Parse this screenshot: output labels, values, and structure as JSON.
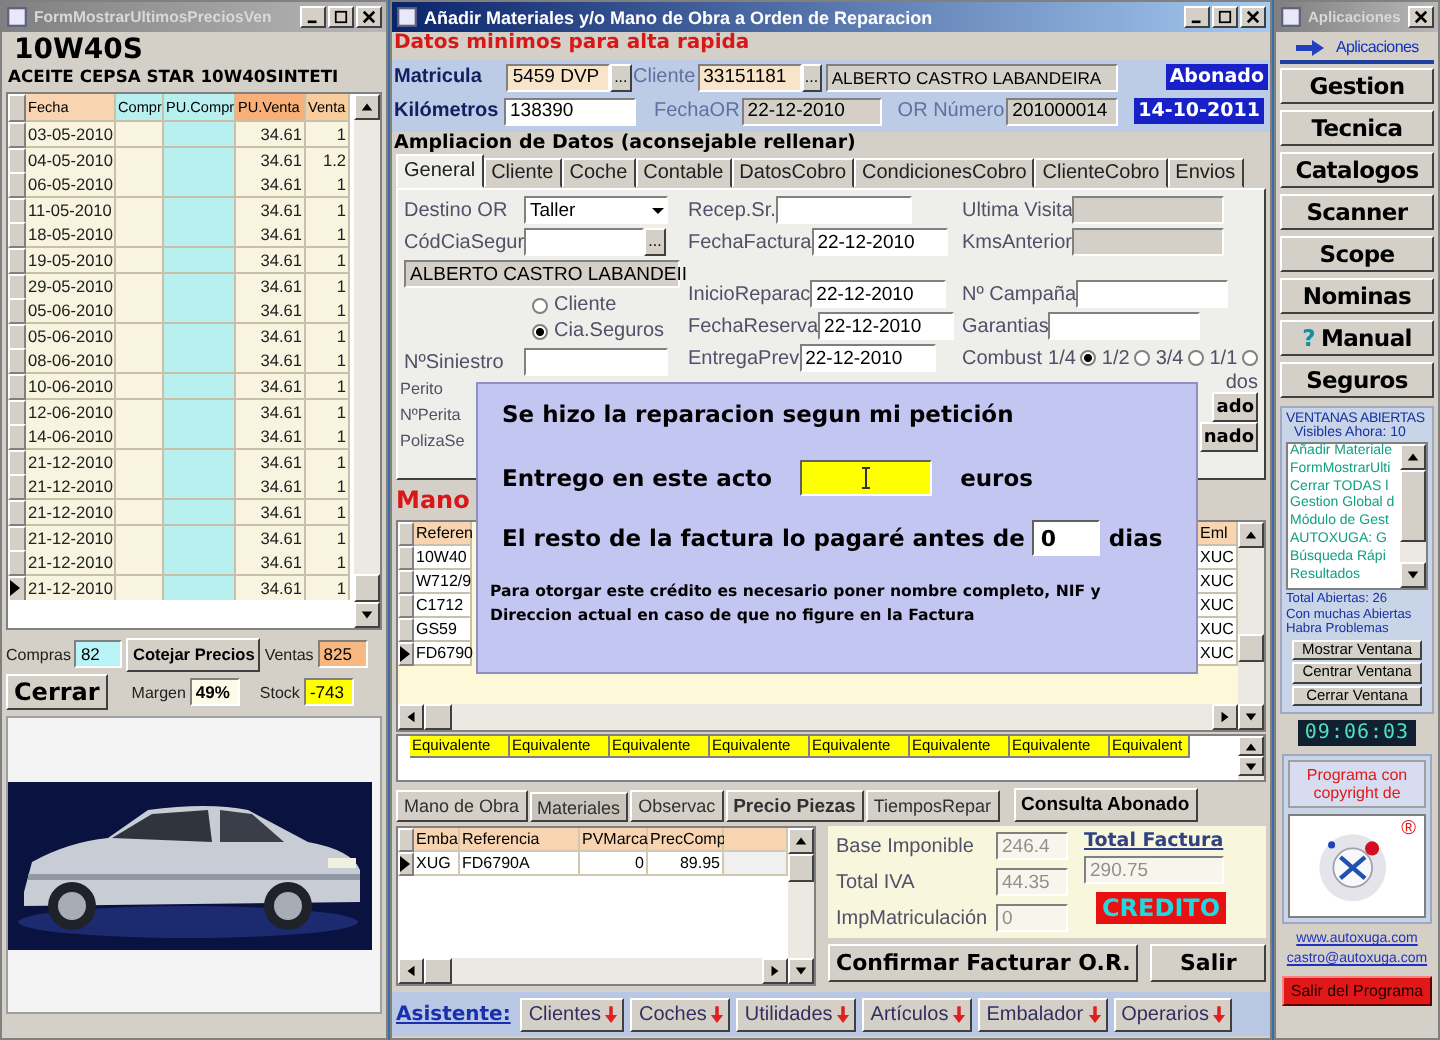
{
  "left_window": {
    "title": "FormMostrarUltimosPreciosVen",
    "code": "10W40S",
    "description": "ACEITE CEPSA STAR 10W40SINTETI",
    "columns": [
      "Fecha",
      "Compr",
      "PU.Compr",
      "PU.Venta",
      "Venta"
    ],
    "rows": [
      {
        "fecha": "03-05-2010",
        "pu_venta": "34.61",
        "venta": "1",
        "selected": false
      },
      {
        "fecha": "04-05-2010",
        "pu_venta": "34.61",
        "venta": "1.2",
        "selected": false
      },
      {
        "fecha": "06-05-2010",
        "pu_venta": "34.61",
        "venta": "1",
        "selected": false
      },
      {
        "fecha": "11-05-2010",
        "pu_venta": "34.61",
        "venta": "1",
        "selected": false
      },
      {
        "fecha": "18-05-2010",
        "pu_venta": "34.61",
        "venta": "1",
        "selected": false
      },
      {
        "fecha": "19-05-2010",
        "pu_venta": "34.61",
        "venta": "1",
        "selected": false
      },
      {
        "fecha": "29-05-2010",
        "pu_venta": "34.61",
        "venta": "1",
        "selected": false
      },
      {
        "fecha": "05-06-2010",
        "pu_venta": "34.61",
        "venta": "1",
        "selected": false
      },
      {
        "fecha": "05-06-2010",
        "pu_venta": "34.61",
        "venta": "1",
        "selected": false
      },
      {
        "fecha": "08-06-2010",
        "pu_venta": "34.61",
        "venta": "1",
        "selected": false
      },
      {
        "fecha": "10-06-2010",
        "pu_venta": "34.61",
        "venta": "1",
        "selected": false
      },
      {
        "fecha": "12-06-2010",
        "pu_venta": "34.61",
        "venta": "1",
        "selected": false
      },
      {
        "fecha": "14-06-2010",
        "pu_venta": "34.61",
        "venta": "1",
        "selected": false
      },
      {
        "fecha": "21-12-2010",
        "pu_venta": "34.61",
        "venta": "1",
        "selected": false
      },
      {
        "fecha": "21-12-2010",
        "pu_venta": "34.61",
        "venta": "1",
        "selected": false
      },
      {
        "fecha": "21-12-2010",
        "pu_venta": "34.61",
        "venta": "1",
        "selected": false
      },
      {
        "fecha": "21-12-2010",
        "pu_venta": "34.61",
        "venta": "1",
        "selected": false
      },
      {
        "fecha": "21-12-2010",
        "pu_venta": "34.61",
        "venta": "1",
        "selected": false
      },
      {
        "fecha": "21-12-2010",
        "pu_venta": "34.61",
        "venta": "1",
        "selected": true
      }
    ],
    "compras": {
      "label": "Compras",
      "value": "82"
    },
    "cotejar_button": "Cotejar Precios",
    "ventas": {
      "label": "Ventas",
      "value": "825"
    },
    "cerrar_button": "Cerrar",
    "margen": {
      "label": "Margen",
      "value": "49%"
    },
    "stock": {
      "label": "Stock",
      "value": "-743"
    },
    "photo": {
      "kind": "picture"
    }
  },
  "main_window": {
    "title": "Añadir Materiales y/o Mano de Obra a Orden de Reparacion",
    "heading": "Datos minimos para alta rapida",
    "matricula": {
      "label": "Matricula",
      "value": "5459 DVP",
      "browse": "..."
    },
    "cliente": {
      "label": "Cliente",
      "value": "33151181",
      "browse": "...",
      "name": "ALBERTO CASTRO LABANDEIRA"
    },
    "abonado_badge": "Abonado",
    "kilometros": {
      "label": "Kilómetros",
      "value": "138390"
    },
    "fecha_or": {
      "label": "FechaOR",
      "value": "22-12-2010"
    },
    "or_numero": {
      "label": "OR Número",
      "value": "201000014"
    },
    "date_badge": "14-10-2011",
    "section_title": "Ampliacion de Datos (aconsejable rellenar)",
    "tabs": [
      {
        "label": "General",
        "selected": true
      },
      {
        "label": "Cliente",
        "selected": false
      },
      {
        "label": "Coche",
        "selected": false
      },
      {
        "label": "Contable",
        "selected": false
      },
      {
        "label": "DatosCobro",
        "selected": false
      },
      {
        "label": "CondicionesCobro",
        "selected": false
      },
      {
        "label": "ClienteCobro",
        "selected": false
      },
      {
        "label": "Envios",
        "selected": false
      }
    ],
    "general": {
      "destino": {
        "label": "Destino OR",
        "value": "Taller"
      },
      "cod_cia": {
        "label": "CódCiaSegur",
        "browse": "..."
      },
      "cia_name": "ALBERTO CASTRO LABANDEII",
      "radios": [
        {
          "label": "Cliente",
          "selected": false
        },
        {
          "label": "Cia.Seguros",
          "selected": true
        }
      ],
      "siniestro": {
        "label": "NºSiniestro"
      },
      "perito": "Perito",
      "num_perito": "NºPerita",
      "poliza": "PolizaSe",
      "recep": {
        "label": "Recep.Sr."
      },
      "fecha_factura": {
        "label": "FechaFactura",
        "value": "22-12-2010"
      },
      "inicio": {
        "label": "InicioReparac",
        "value": "22-12-2010"
      },
      "fecha_reserva": {
        "label": "FechaReserva",
        "value": "22-12-2010"
      },
      "entrega": {
        "label": "EntregaPrev",
        "value": "22-12-2010"
      },
      "ultima_visita": {
        "label": "Ultima Visita"
      },
      "kms_anterior": {
        "label": "KmsAnterior"
      },
      "campana": {
        "label": "Nº Campaña"
      },
      "garantias": {
        "label": "Garantias"
      },
      "combust": {
        "label": "Combust",
        "options": [
          {
            "label": "1/4",
            "selected": true
          },
          {
            "label": "1/2",
            "selected": false
          },
          {
            "label": "3/4",
            "selected": false
          },
          {
            "label": "1/1",
            "selected": false
          }
        ]
      },
      "cut_label": "dos",
      "cut_buttons": [
        "ado",
        "nado"
      ]
    },
    "mano_label": "Mano",
    "parts_grid": {
      "column_1": "Referen",
      "column_last": "Eml",
      "rows": [
        {
          "ref": "10W40",
          "last": "XUC",
          "selected": false
        },
        {
          "ref": "W712/9",
          "last": "XUC",
          "selected": false
        },
        {
          "ref": "C1712",
          "last": "XUC",
          "selected": false
        },
        {
          "ref": "GS59",
          "last": "XUC",
          "selected": false
        },
        {
          "ref": "FD6790",
          "last": "XUC",
          "selected": true
        }
      ]
    },
    "equivalents": [
      "Equivalente",
      "Equivalente",
      "Equivalente",
      "Equivalente",
      "Equivalente",
      "Equivalente",
      "Equivalente",
      "Equivalent"
    ],
    "dialog": {
      "title": "Se hizo la reparacion segun mi petición",
      "entrego_label": "Entrego en este acto",
      "entrego_unit": "euros",
      "resto_label": "El resto de la factura lo pagaré antes de",
      "resto_value": "0",
      "resto_unit": "dias",
      "note": "Para otorgar este crédito es necesario poner nombre completo, NIF y Direccion actual en caso de que no figure en la Factura"
    },
    "bottom_tabs": [
      {
        "label": "Mano de Obra",
        "selected": false
      },
      {
        "label": "Materiales",
        "selected": true
      },
      {
        "label": "Observac",
        "selected": false
      },
      {
        "label": "Precio Piezas",
        "selected": false
      },
      {
        "label": "TiemposRepar",
        "selected": false
      }
    ],
    "consulta_button": "Consulta Abonado",
    "materials": {
      "columns": [
        "Emba",
        "Referencia",
        "PVMarca",
        "PrecComp"
      ],
      "rows": [
        {
          "emba": "XUG",
          "referencia": "FD6790A",
          "pv_marca": "0",
          "prec_comp": "89.95",
          "selected": true
        }
      ]
    },
    "totals": {
      "base": {
        "label": "Base Imponible",
        "value": "246.4"
      },
      "iva": {
        "label": "Total IVA",
        "value": "44.35"
      },
      "matriculacion": {
        "label": "ImpMatriculación",
        "value": "0"
      },
      "total": {
        "label": "Total Factura",
        "value": "290.75"
      },
      "badge": "CREDITO"
    },
    "confirm_button": "Confirmar Facturar O.R.",
    "salir_button": "Salir",
    "asistente": {
      "label": "Asistente:",
      "buttons": [
        "Clientes",
        "Coches",
        "Utilidades",
        "Artículos",
        "Embalador",
        "Operarios"
      ]
    }
  },
  "apps_window": {
    "title": "Aplicaciones",
    "header": "Aplicaciones",
    "buttons": [
      {
        "label": "Gestion"
      },
      {
        "label": "Tecnica"
      },
      {
        "label": "Catalogos"
      },
      {
        "label": "Scanner"
      },
      {
        "label": "Scope"
      },
      {
        "label": "Nominas"
      },
      {
        "label": "Manual",
        "glyph": "?"
      },
      {
        "label": "Seguros"
      }
    ],
    "ventanas_title": "VENTANAS ABIERTAS",
    "visibles": "Visibles Ahora: 10",
    "ventanas": [
      "Añadir Materiale",
      "FormMostrarUlti",
      "Cerrar TODAS l",
      "Gestion Global d",
      "Módulo de Gest",
      "AUTOXUGA:  G",
      "Búsqueda Rápi",
      "Resultados"
    ],
    "status_lines": [
      "Total Abiertas: 26",
      "Con muchas Abiertas",
      "Habra Problemas"
    ],
    "window_buttons": [
      "Mostrar Ventana",
      "Centrar Ventana",
      "Cerrar Ventana"
    ],
    "clock": "09:06:03",
    "copyright": "Programa con copyright de",
    "registered_mark": "®",
    "links": [
      "www.autoxuga.com",
      "castro@autoxuga.com"
    ],
    "exit_button": "Salir del Programa"
  }
}
